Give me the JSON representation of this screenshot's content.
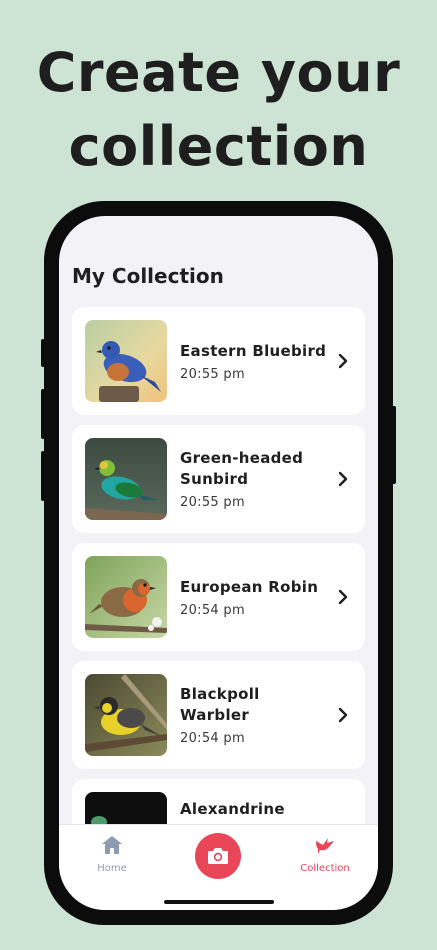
{
  "headline": {
    "line1": "Create your",
    "line2": "collection"
  },
  "screen": {
    "title": "My Collection"
  },
  "collection": [
    {
      "name_line1": "Eastern Bluebird",
      "name_line2": "",
      "time": "20:55 pm",
      "image": "eastern-bluebird-photo"
    },
    {
      "name_line1": "Green-headed",
      "name_line2": "Sunbird",
      "time": "20:55 pm",
      "image": "green-headed-sunbird-photo"
    },
    {
      "name_line1": "European Robin",
      "name_line2": "",
      "time": "20:54 pm",
      "image": "european-robin-photo"
    },
    {
      "name_line1": "Blackpoll Warbler",
      "name_line2": "",
      "time": "20:54 pm",
      "image": "blackpoll-warbler-photo"
    },
    {
      "name_line1": "Alexandrine",
      "name_line2": "",
      "time": "",
      "image": "alexandrine-photo"
    }
  ],
  "tabbar": {
    "home_label": "Home",
    "collection_label": "Collection",
    "home_icon": "house-icon",
    "camera_icon": "camera-icon",
    "collection_icon": "bird-icon",
    "active_color": "#e94658",
    "inactive_color": "#8e9bb0"
  },
  "colors": {
    "background": "#cde3d3",
    "accent": "#e94658"
  }
}
